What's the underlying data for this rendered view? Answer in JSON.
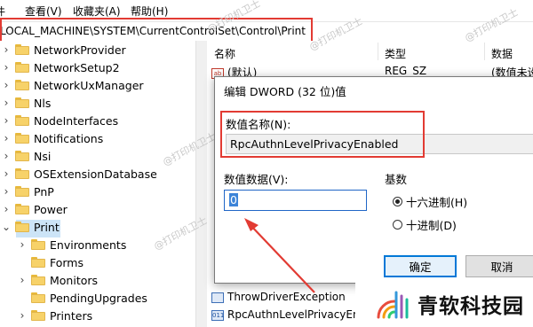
{
  "menu": {
    "items": [
      "查看(V)",
      "收藏夹(A)",
      "帮助(H)"
    ],
    "partial": "件"
  },
  "address": {
    "path": "LOCAL_MACHINE\\SYSTEM\\CurrentControlSet\\Control\\Print"
  },
  "tree": {
    "items": [
      {
        "label": "NetworkProvider",
        "expand": "›"
      },
      {
        "label": "NetworkSetup2",
        "expand": "›"
      },
      {
        "label": "NetworkUxManager",
        "expand": "›"
      },
      {
        "label": "Nls",
        "expand": "›"
      },
      {
        "label": "NodeInterfaces",
        "expand": "›"
      },
      {
        "label": "Notifications",
        "expand": "›"
      },
      {
        "label": "Nsi",
        "expand": "›"
      },
      {
        "label": "OSExtensionDatabase",
        "expand": "›"
      },
      {
        "label": "PnP",
        "expand": "›"
      },
      {
        "label": "Power",
        "expand": "›"
      },
      {
        "label": "Print",
        "expand": "⌄"
      },
      {
        "label": "Environments",
        "expand": "›"
      },
      {
        "label": "Forms",
        "expand": ""
      },
      {
        "label": "Monitors",
        "expand": "›"
      },
      {
        "label": "PendingUpgrades",
        "expand": ""
      },
      {
        "label": "Printers",
        "expand": "›"
      }
    ]
  },
  "list": {
    "headers": {
      "name": "名称",
      "type": "类型",
      "data": "数据"
    },
    "rows": [
      {
        "icon": "ab",
        "name": "(默认)",
        "type": "REG_SZ",
        "data": "(数值未设"
      },
      {
        "icon": "",
        "name": "ThrowDriverException",
        "type": "",
        "data": ""
      },
      {
        "icon": "011",
        "name": "RpcAuthnLevelPrivacyEnabled",
        "type": "",
        "data": ""
      }
    ]
  },
  "dialog": {
    "title": "编辑 DWORD (32 位)值",
    "name_label": "数值名称(N):",
    "name_value": "RpcAuthnLevelPrivacyEnabled",
    "data_label": "数值数据(V):",
    "data_value": "0",
    "base_label": "基数",
    "radio_hex": "十六进制(H)",
    "radio_dec": "十进制(D)",
    "ok": "确定",
    "cancel": "取消"
  },
  "watermark": "@打印机卫士",
  "logo": {
    "text": "青软科技园"
  },
  "colors": {
    "annotation_red": "#e23b33",
    "selection": "#cce4f7",
    "accent": "#0078d7"
  }
}
